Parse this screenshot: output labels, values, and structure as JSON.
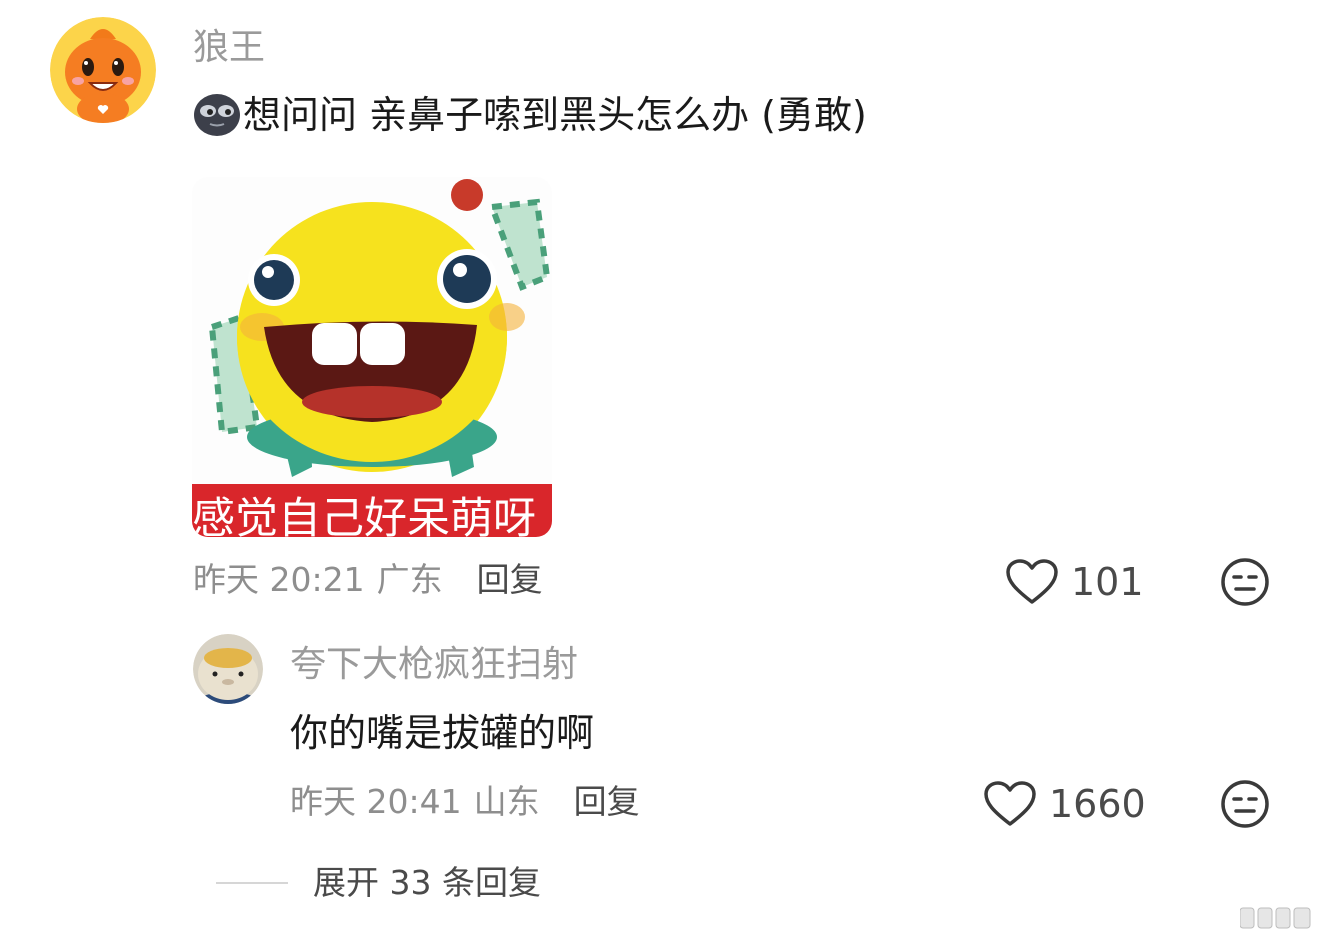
{
  "comment": {
    "username": "狼王",
    "text": "想问问 亲鼻子嗦到黑头怎么办 (勇敢)",
    "sticker_caption": "感觉自己好呆萌呀",
    "time": "昨天 20:21",
    "location": "广东",
    "reply_label": "回复",
    "likes": "101"
  },
  "reply": {
    "username": "夸下大枪疯狂扫射",
    "text": "你的嘴是拔罐的啊",
    "time": "昨天 20:41",
    "location": "山东",
    "reply_label": "回复",
    "likes": "1660"
  },
  "expand_label": "展开 33 条回复",
  "colors": {
    "username": "#9a9a9a",
    "meta": "#8e8e8e",
    "sticker_banner": "#d9262b",
    "avatar_bg": "#fcd44a"
  },
  "icons": [
    "heart-icon",
    "neutral-face-icon",
    "dark-face-emoji-icon",
    "watermark-icon"
  ]
}
